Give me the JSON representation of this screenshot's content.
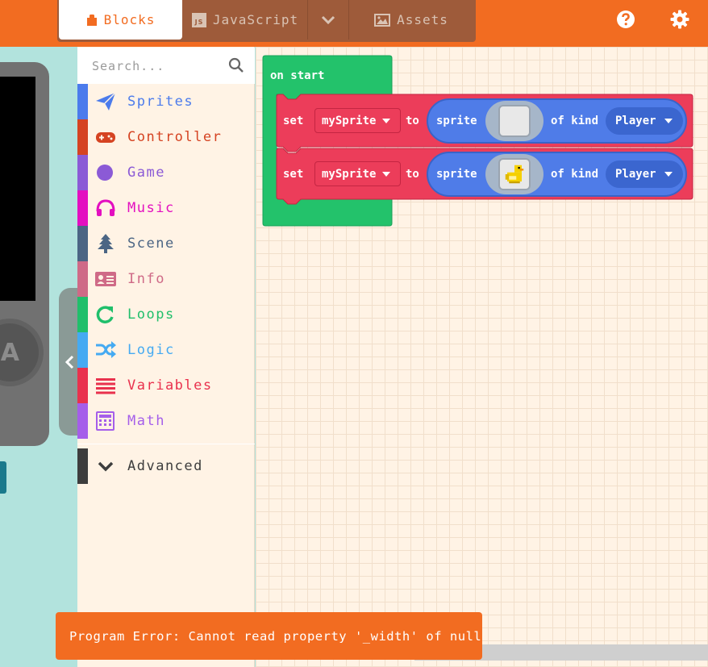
{
  "header": {
    "tabs": {
      "blocks": "Blocks",
      "javascript": "JavaScript",
      "assets": "Assets"
    },
    "js_badge": "JS",
    "colors": {
      "header": "#f26c21",
      "tabgroup": "#9e5b3a"
    }
  },
  "simulator": {
    "a_button": "A"
  },
  "toolbox": {
    "search_placeholder": "Search...",
    "categories": [
      {
        "label": "Sprites",
        "color": "#4b7bec",
        "icon": "paper-plane-icon"
      },
      {
        "label": "Controller",
        "color": "#d54322",
        "icon": "gamepad-icon"
      },
      {
        "label": "Game",
        "color": "#8b5ad6",
        "icon": "circle-icon"
      },
      {
        "label": "Music",
        "color": "#e30fc0",
        "icon": "headphones-icon"
      },
      {
        "label": "Scene",
        "color": "#4b6584",
        "icon": "tree-icon"
      },
      {
        "label": "Info",
        "color": "#cf6a87",
        "icon": "id-card-icon"
      },
      {
        "label": "Loops",
        "color": "#20bf6b",
        "icon": "refresh-icon"
      },
      {
        "label": "Logic",
        "color": "#45aaf2",
        "icon": "shuffle-icon"
      },
      {
        "label": "Variables",
        "color": "#e9314d",
        "icon": "list-icon"
      },
      {
        "label": "Math",
        "color": "#a55eea",
        "icon": "calculator-icon"
      }
    ],
    "advanced": {
      "label": "Advanced",
      "color": "#3d3d3d"
    }
  },
  "workspace": {
    "on_start": "on start",
    "statements": [
      {
        "set": "set",
        "variable": "mySprite",
        "to": "to",
        "sprite": "sprite",
        "of_kind": "of kind",
        "kind": "Player",
        "image": "blank"
      },
      {
        "set": "set",
        "variable": "mySprite",
        "to": "to",
        "sprite": "sprite",
        "of_kind": "of kind",
        "kind": "Player",
        "image": "duck"
      }
    ],
    "colors": {
      "event": "#23c26b",
      "set": "#ec3d5a",
      "sprite": "#4f7ce8"
    }
  },
  "error": {
    "message": "Program Error: Cannot read property '_width' of null"
  }
}
